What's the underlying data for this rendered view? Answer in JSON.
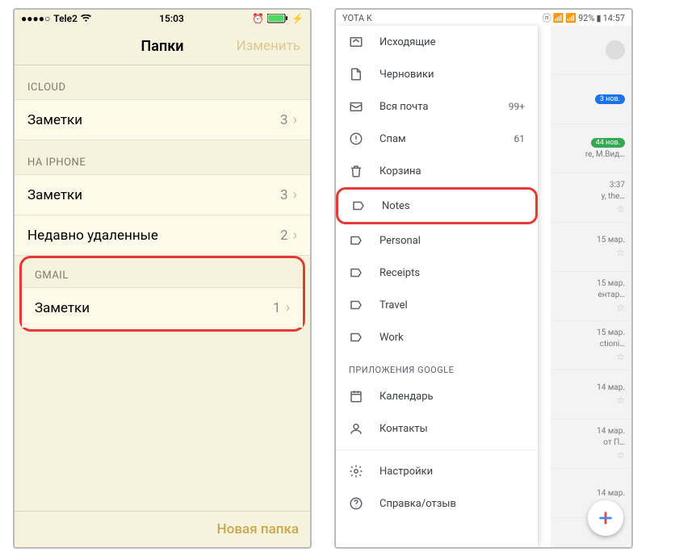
{
  "ios": {
    "status": {
      "carrier": "Tele2",
      "time": "15:03"
    },
    "nav": {
      "title": "Папки",
      "edit": "Изменить"
    },
    "sections": [
      {
        "header": "ICLOUD",
        "rows": [
          {
            "label": "Заметки",
            "count": "3"
          }
        ]
      },
      {
        "header": "НА IPHONE",
        "rows": [
          {
            "label": "Заметки",
            "count": "3"
          },
          {
            "label": "Недавно удаленные",
            "count": "2"
          }
        ]
      },
      {
        "header": "GMAIL",
        "rows": [
          {
            "label": "Заметки",
            "count": "1"
          }
        ],
        "highlight": true
      }
    ],
    "toolbar": {
      "newFolder": "Новая папка"
    }
  },
  "android": {
    "status": {
      "carrier": "YOTA K",
      "battery": "92%",
      "time": "14:57"
    },
    "drawer": {
      "items": [
        {
          "icon": "outbox",
          "label": "Исходящие"
        },
        {
          "icon": "draft",
          "label": "Черновики"
        },
        {
          "icon": "allmail",
          "label": "Вся почта",
          "count": "99+"
        },
        {
          "icon": "spam",
          "label": "Спам",
          "count": "61"
        },
        {
          "icon": "trash",
          "label": "Корзина"
        },
        {
          "icon": "label",
          "label": "Notes",
          "highlight": true
        },
        {
          "icon": "label",
          "label": "Personal"
        },
        {
          "icon": "label",
          "label": "Receipts"
        },
        {
          "icon": "label",
          "label": "Travel"
        },
        {
          "icon": "label",
          "label": "Work"
        }
      ],
      "sectionLabel": "ПРИЛОЖЕНИЯ GOOGLE",
      "apps": [
        {
          "icon": "calendar",
          "label": "Календарь"
        },
        {
          "icon": "contacts",
          "label": "Контакты"
        }
      ],
      "footer": [
        {
          "icon": "settings",
          "label": "Настройки"
        },
        {
          "icon": "help",
          "label": "Справка/отзыв"
        }
      ]
    },
    "bgList": [
      {
        "badge": "3 нов.",
        "badgeClass": "blue"
      },
      {
        "badge": "44 нов.",
        "badgeClass": "green",
        "sub": "re, М.Вид…"
      },
      {
        "time": "3:37",
        "sub": "y, the…"
      },
      {
        "time": "15 мар."
      },
      {
        "time": "15 мар.",
        "sub": "ентар…"
      },
      {
        "time": "15 мар.",
        "sub": "ctioni…"
      },
      {
        "time": "14 мар."
      },
      {
        "time": "14 мар.",
        "sub": "от П…"
      },
      {
        "time": "14 мар."
      }
    ]
  }
}
